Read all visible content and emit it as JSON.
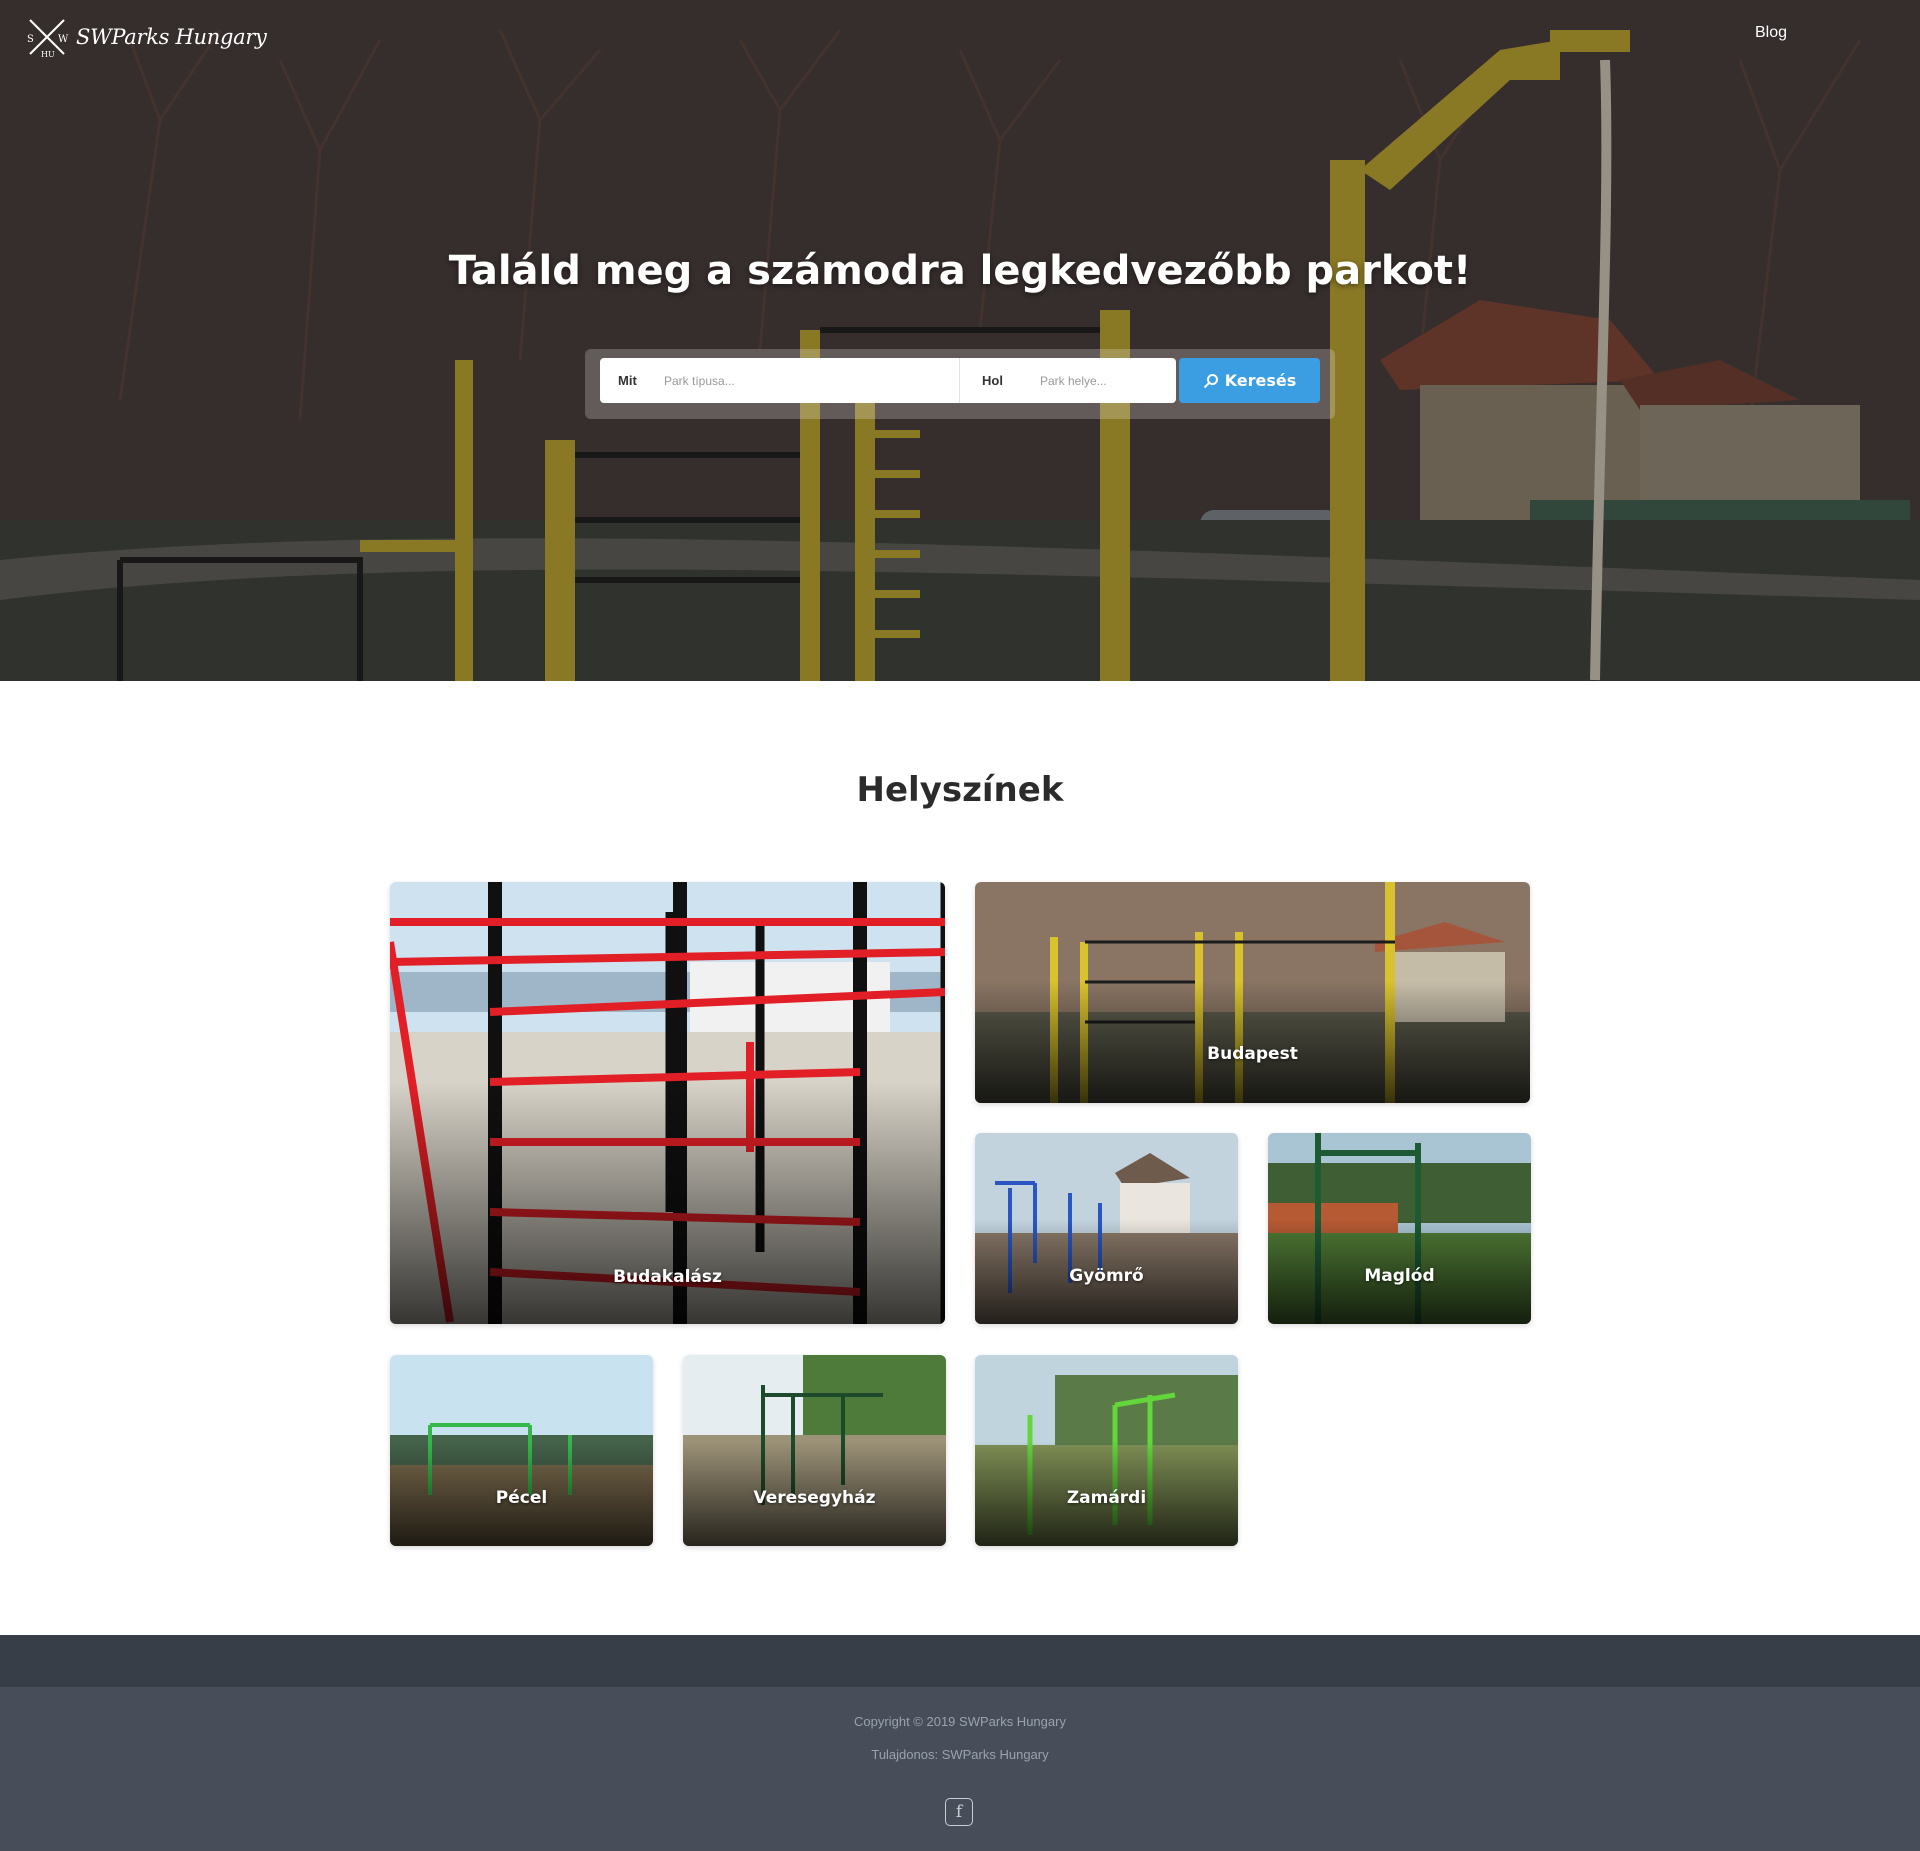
{
  "brand": {
    "name": "SWParks Hungary",
    "logo_icon": "crossed-sticks-logo"
  },
  "nav": {
    "blog": "Blog"
  },
  "hero": {
    "title": "Találd meg a számodra legkedvezőbb parkot!",
    "search": {
      "what_label": "Mit",
      "what_placeholder": "Park típusa...",
      "where_label": "Hol",
      "where_placeholder": "Park helye...",
      "button": "Keresés",
      "button_icon": "search-icon"
    }
  },
  "locations": {
    "title": "Helyszínek",
    "items": [
      {
        "name": "Budakalász"
      },
      {
        "name": "Budapest"
      },
      {
        "name": "Gyömrő"
      },
      {
        "name": "Maglód"
      },
      {
        "name": "Pécel"
      },
      {
        "name": "Veresegyház"
      },
      {
        "name": "Zamárdi"
      }
    ]
  },
  "footer": {
    "copyright": "Copyright © 2019 SWParks Hungary",
    "owner": "Tulajdonos: SWParks Hungary",
    "social_icon": "facebook-icon"
  },
  "colors": {
    "accent": "#3b9ee2",
    "footer_dark": "#383e48",
    "footer": "#474e59"
  }
}
